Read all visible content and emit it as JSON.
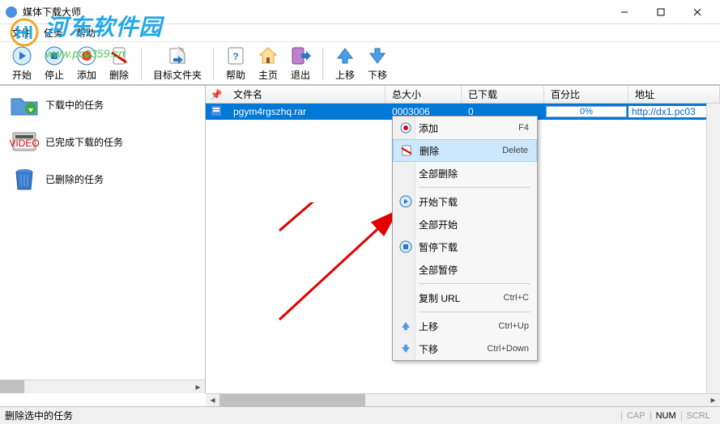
{
  "window": {
    "title": "媒体下载大师"
  },
  "watermark": {
    "title": "河东软件园",
    "url": "www.pc0359.cn"
  },
  "menubar": [
    "文件",
    "任务",
    "帮助"
  ],
  "toolbar": {
    "start": "开始",
    "stop": "停止",
    "add": "添加",
    "delete": "删除",
    "target": "目标文件夹",
    "help": "帮助",
    "home": "主页",
    "exit": "退出",
    "up": "上移",
    "down": "下移"
  },
  "sidebar": {
    "downloading": "下载中的任务",
    "completed": "已完成下载的任务",
    "deleted": "已删除的任务"
  },
  "columns": {
    "filename": "文件名",
    "totalsize": "总大小",
    "downloaded": "已下载",
    "percent": "百分比",
    "address": "地址"
  },
  "rows": [
    {
      "filename": "pgym4rgszhq.rar",
      "totalsize": "0003006",
      "downloaded": "0",
      "percent": "0%",
      "address": "http://dx1.pc03"
    }
  ],
  "context_menu": {
    "add": {
      "label": "添加",
      "key": "F4"
    },
    "delete": {
      "label": "删除",
      "key": "Delete"
    },
    "delete_all": {
      "label": "全部删除"
    },
    "start_dl": {
      "label": "开始下载"
    },
    "start_all": {
      "label": "全部开始"
    },
    "pause_dl": {
      "label": "暂停下载"
    },
    "pause_all": {
      "label": "全部暂停"
    },
    "copy_url": {
      "label": "复制 URL",
      "key": "Ctrl+C"
    },
    "move_up": {
      "label": "上移",
      "key": "Ctrl+Up"
    },
    "move_down": {
      "label": "下移",
      "key": "Ctrl+Down"
    }
  },
  "statusbar": {
    "text": "删除选中的任务",
    "cap": "CAP",
    "num": "NUM",
    "scrl": "SCRL"
  }
}
